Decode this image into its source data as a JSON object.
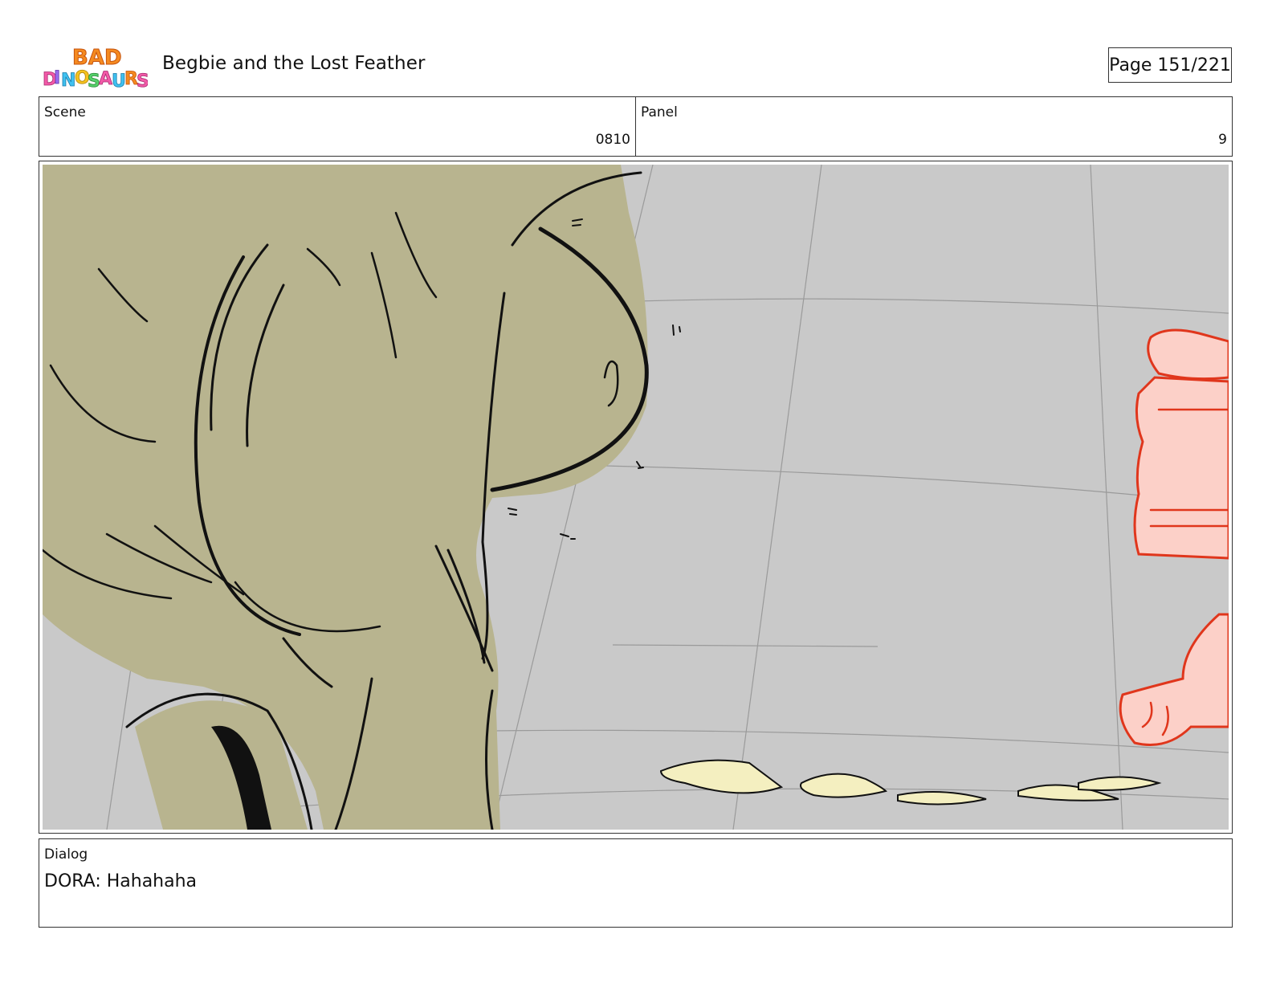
{
  "header": {
    "logo_text_top": "BAD",
    "logo_text_bottom": "DINOSAURS",
    "title": "Begbie and the Lost Feather",
    "page_label": "Page 151/221"
  },
  "info": {
    "scene_label": "Scene",
    "scene_value": "0810",
    "panel_label": "Panel",
    "panel_value": "9"
  },
  "dialog": {
    "label": "Dialog",
    "text": "DORA: Hahahaha"
  },
  "colors": {
    "dino_fill": "#b8b48f",
    "floor": "#c9c9c9",
    "pink_fill": "#fcd0c8",
    "red_line": "#e0361c",
    "feather": "#f4efc0"
  }
}
